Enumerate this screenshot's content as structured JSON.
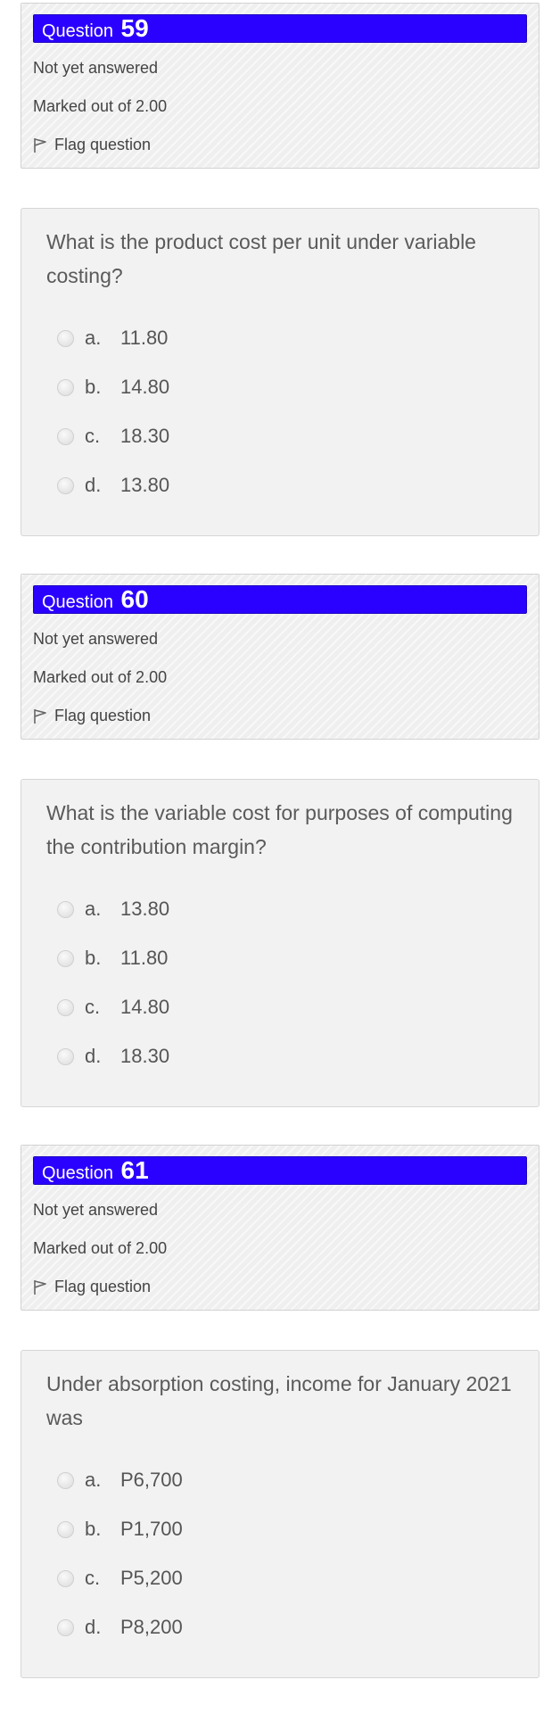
{
  "questions": [
    {
      "word": "Question",
      "number": "59",
      "state": "Not yet answered",
      "grade": "Marked out of 2.00",
      "flag": "Flag question",
      "text": "What is the product cost per unit under variable costing?",
      "answers": [
        {
          "letter": "a.",
          "value": "11.80"
        },
        {
          "letter": "b.",
          "value": "14.80"
        },
        {
          "letter": "c.",
          "value": "18.30"
        },
        {
          "letter": "d.",
          "value": "13.80"
        }
      ]
    },
    {
      "word": "Question",
      "number": "60",
      "state": "Not yet answered",
      "grade": "Marked out of 2.00",
      "flag": "Flag question",
      "text": "What is the variable cost for purposes of computing the contribution margin?",
      "answers": [
        {
          "letter": "a.",
          "value": "13.80"
        },
        {
          "letter": "b.",
          "value": "11.80"
        },
        {
          "letter": "c.",
          "value": "14.80"
        },
        {
          "letter": "d.",
          "value": "18.30"
        }
      ]
    },
    {
      "word": "Question",
      "number": "61",
      "state": "Not yet answered",
      "grade": "Marked out of 2.00",
      "flag": "Flag question",
      "text": "Under absorption costing, income for January 2021 was",
      "answers": [
        {
          "letter": "a.",
          "value": "P6,700"
        },
        {
          "letter": "b.",
          "value": "P1,700"
        },
        {
          "letter": "c.",
          "value": "P5,200"
        },
        {
          "letter": "d.",
          "value": "P8,200"
        }
      ]
    }
  ],
  "colors": {
    "question_number_bg": "#2a00ff"
  },
  "icons": {
    "flag": "flag-icon"
  }
}
